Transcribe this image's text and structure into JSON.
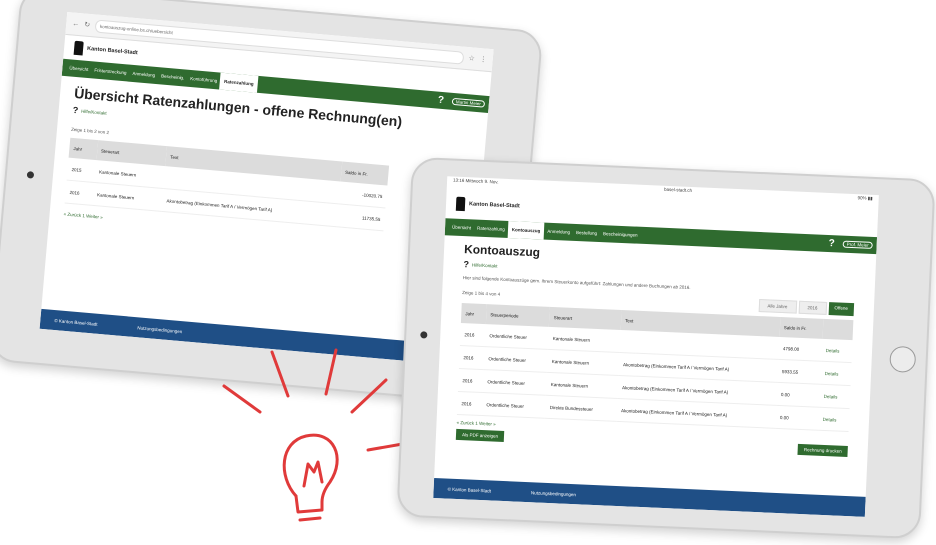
{
  "tablet_back": {
    "url": "kontoauszug-online.bs.ch/uebersicht",
    "brand": "Kanton Basel-Stadt",
    "nav": [
      "Übersicht",
      "Fristerstreckung",
      "Anmeldung",
      "Bescheinig.",
      "Kontoführung"
    ],
    "nav_active": "Ratenzahlung",
    "help_symbol": "?",
    "user": "Martin Meier",
    "title": "Übersicht Ratenzahlungen - offene Rechnung(en)",
    "help_link": "Hilfe/Kontakt",
    "count_label": "Zeige 1 bis 2 von 2",
    "columns": [
      "Jahr",
      "Steuerart",
      "Text",
      "Saldo in Fr."
    ],
    "rows": [
      {
        "jahr": "2015",
        "steuerart": "Kantonale Steuern",
        "text": "",
        "saldo": "-10020.75"
      },
      {
        "jahr": "2016",
        "steuerart": "Kantonale Steuern",
        "text": "Akontobetrag (Einkommen Tarif A / Vermögen Tarif A)",
        "saldo": "11735.55"
      }
    ],
    "pager": "« Zurück   1   Weiter »",
    "footer_left": "© Kanton Basel-Stadt",
    "footer_right": "Nutzungsbedingungen"
  },
  "tablet_front": {
    "status_time": "13:16  Mittwoch 9. Nov.",
    "status_right": "90% ▮▮",
    "url": "basel-stadt.ch",
    "brand": "Kanton Basel-Stadt",
    "nav": [
      "Übersicht",
      "Ratenzahlung"
    ],
    "nav_active": "Kontoauszug",
    "nav_after": [
      "Anmeldung",
      "Bestellung",
      "Bescheinigungen"
    ],
    "help_symbol": "?",
    "user": "Prof. Meier",
    "title": "Kontoauszug",
    "help_link": "Hilfe/Kontakt",
    "intro": "Hier sind folgende Kontoauszüge gem. Ihrem Steuerkonto aufgeführt: Zahlungen und andere Buchungen ab 2016.",
    "count_label": "Zeige 1 bis 4 von 4",
    "filters": [
      "Alle Jahre",
      "2016",
      "Offene"
    ],
    "columns": [
      "Jahr",
      "Steuerperiode",
      "Steuerart",
      "Text",
      "Saldo in Fr.",
      ""
    ],
    "rows": [
      {
        "jahr": "2016",
        "periode": "Ordentliche Steuer",
        "art": "Kantonale Steuern",
        "text": "",
        "saldo": "4798.00",
        "action": "Details"
      },
      {
        "jahr": "2016",
        "periode": "Ordentliche Steuer",
        "art": "Kantonale Steuern",
        "text": "Akontobetrag (Einkommen Tarif A / Vermögen Tarif A)",
        "saldo": "5933.55",
        "action": "Details"
      },
      {
        "jahr": "2016",
        "periode": "Ordentliche Steuer",
        "art": "Kantonale Steuern",
        "text": "Akontobetrag (Einkommen Tarif A / Vermögen Tarif A)",
        "saldo": "0.00",
        "action": "Details"
      },
      {
        "jahr": "2016",
        "periode": "Ordentliche Steuer",
        "art": "Direkte Bundessteuer",
        "text": "Akontobetrag (Einkommen Tarif A / Vermögen Tarif A)",
        "saldo": "0.00",
        "action": "Details"
      }
    ],
    "pager": "« Zurück   1   Weiter »",
    "pdf_button": "Als PDF anzeigen",
    "right_button": "Rechnung drucken",
    "footer_left": "© Kanton Basel-Stadt",
    "footer_right": "Nutzungsbedingungen"
  },
  "colors": {
    "accent": "#2f6b2f",
    "footer": "#1f4f86",
    "sketch": "#e03a3a"
  },
  "decoration": "lightbulb-sketch"
}
